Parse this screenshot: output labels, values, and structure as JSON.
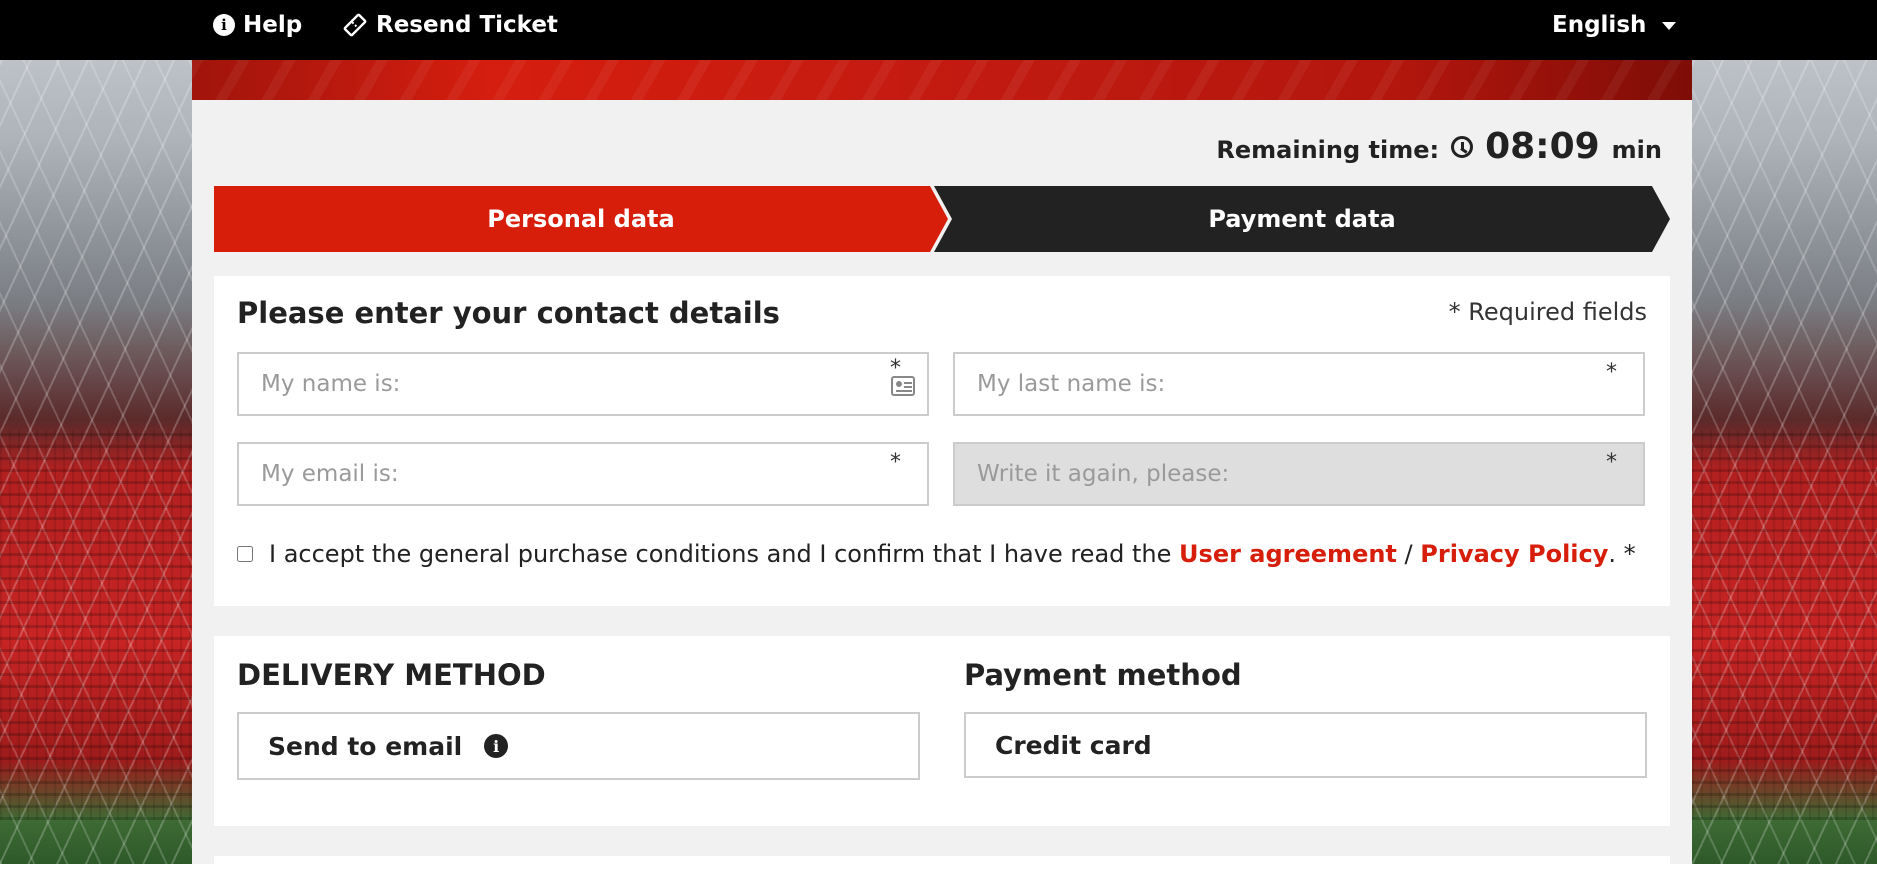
{
  "topbar": {
    "help_label": "Help",
    "resend_label": "Resend Ticket",
    "language": "English"
  },
  "timer": {
    "label": "Remaining time:",
    "value": "08:09",
    "unit": "min"
  },
  "steps": {
    "personal": "Personal data",
    "payment": "Payment data"
  },
  "contact": {
    "title": "Please enter your contact details",
    "required_note": "* Required fields",
    "name_placeholder": "My name is:",
    "last_name_placeholder": "My last name is:",
    "email_placeholder": "My email is:",
    "email_again_placeholder": "Write it again, please:",
    "required_star": "*",
    "terms_text": "I accept the general purchase conditions and I confirm that I have read the",
    "user_agreement": "User agreement",
    "separator": "/",
    "privacy_policy": "Privacy Policy",
    "terms_end": ". *"
  },
  "delivery": {
    "title": "DELIVERY METHOD",
    "option": "Send to email"
  },
  "payment": {
    "title": "Payment method",
    "option": "Credit card"
  },
  "colors": {
    "accent": "#d71e0b",
    "dark": "#222222"
  }
}
